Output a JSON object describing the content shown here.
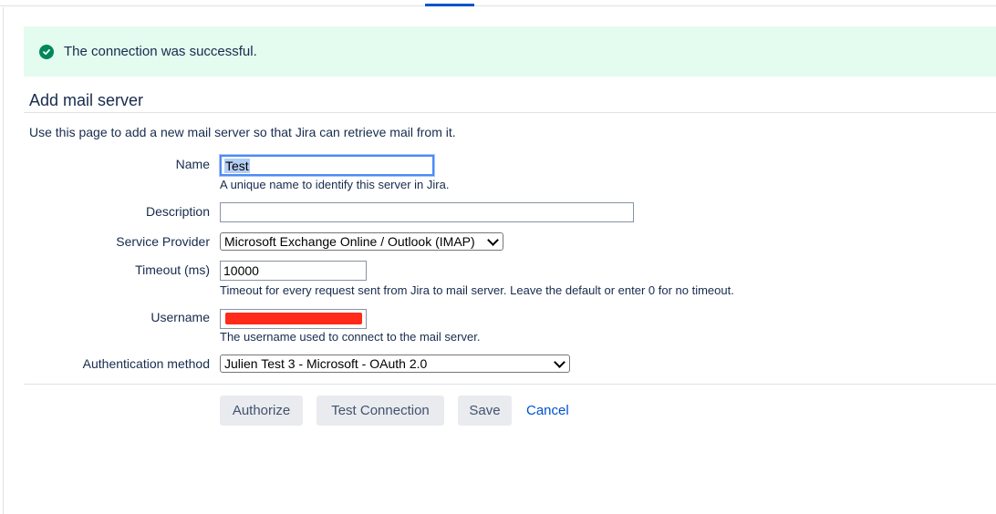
{
  "banner": {
    "message": "The connection was successful.",
    "icon": "check-circle-icon",
    "color": "#00875a"
  },
  "page": {
    "title": "Add mail server",
    "intro": "Use this page to add a new mail server so that Jira can retrieve mail from it."
  },
  "form": {
    "name": {
      "label": "Name",
      "value": "Test",
      "help": "A unique name to identify this server in Jira."
    },
    "description": {
      "label": "Description",
      "value": ""
    },
    "service_provider": {
      "label": "Service Provider",
      "value": "Microsoft Exchange Online / Outlook (IMAP)"
    },
    "timeout": {
      "label": "Timeout (ms)",
      "value": "10000",
      "help": "Timeout for every request sent from Jira to mail server. Leave the default or enter 0 for no timeout."
    },
    "username": {
      "label": "Username",
      "value": "",
      "help": "The username used to connect to the mail server.",
      "redacted": true
    },
    "auth_method": {
      "label": "Authentication method",
      "value": "Julien Test 3 - Microsoft - OAuth 2.0"
    }
  },
  "actions": {
    "authorize": "Authorize",
    "test_connection": "Test Connection",
    "save": "Save",
    "cancel": "Cancel"
  },
  "colors": {
    "success_bg": "#e3fcef",
    "link": "#0052cc",
    "button_bg": "#e9ebef",
    "redaction": "#ff2a1a"
  }
}
